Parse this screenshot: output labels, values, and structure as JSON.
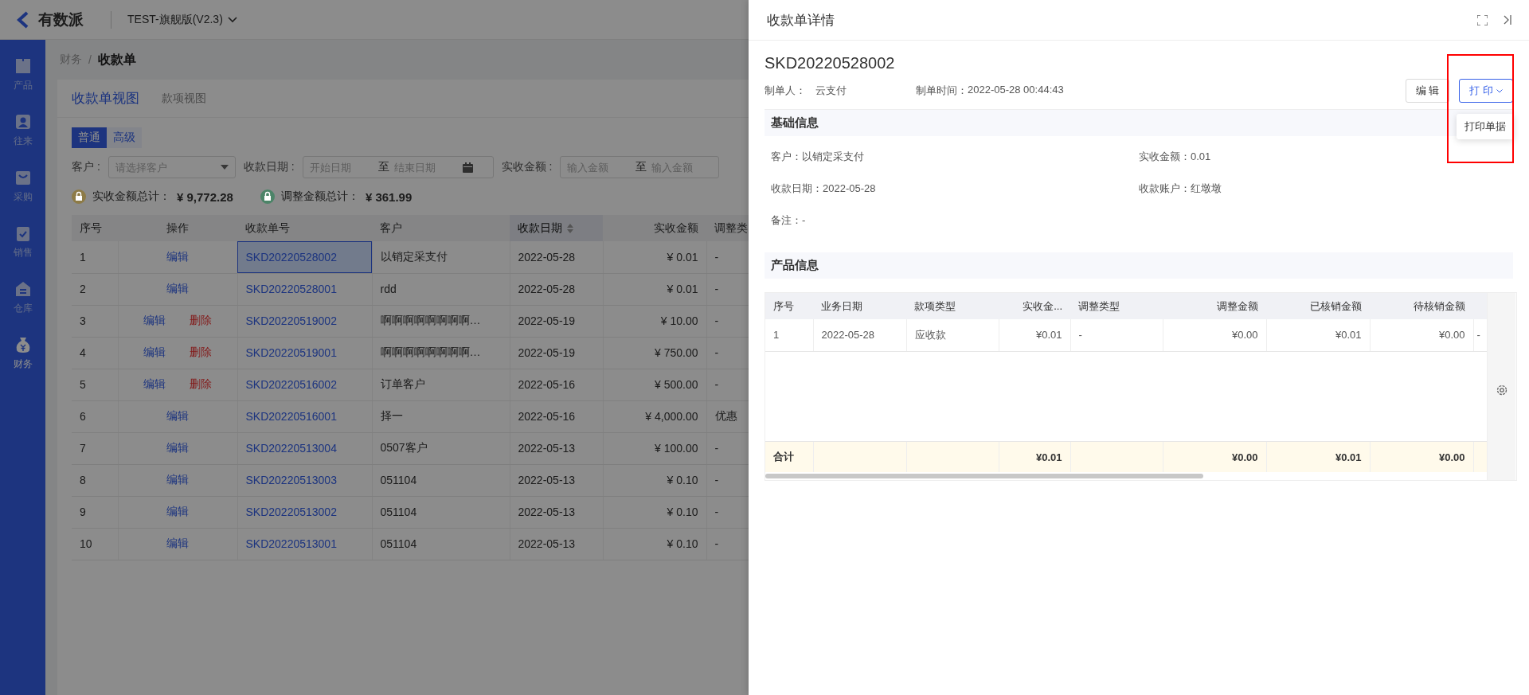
{
  "app": {
    "logo": "有数派",
    "workspace": "TEST-旗舰版(V2.3)"
  },
  "sidebar": {
    "items": [
      {
        "label": "产品",
        "selected": false
      },
      {
        "label": "往来",
        "selected": false
      },
      {
        "label": "采购",
        "selected": false
      },
      {
        "label": "销售",
        "selected": false
      },
      {
        "label": "仓库",
        "selected": false
      },
      {
        "label": "财务",
        "selected": true
      }
    ]
  },
  "breadcrumb": {
    "items": [
      "财务",
      "收款单"
    ],
    "separator": "/"
  },
  "view_tabs": [
    {
      "label": "收款单视图",
      "selected": true
    },
    {
      "label": "款项视图",
      "selected": false
    }
  ],
  "filter_mode": [
    {
      "label": "普通",
      "selected": true
    },
    {
      "label": "高级",
      "selected": false
    }
  ],
  "filters": [
    {
      "kind": "select",
      "label": "客户 :",
      "placeholder": "请选择客户"
    },
    {
      "kind": "date-range",
      "label": "收款日期 :",
      "from_placeholder": "开始日期",
      "separator": "至",
      "to_placeholder": "结束日期"
    },
    {
      "kind": "amount-range",
      "label": "实收金额 :",
      "from_placeholder": "输入金额",
      "separator": "至",
      "to_placeholder": "输入金额"
    }
  ],
  "totals": [
    {
      "label": "实收金额总计：",
      "value": "¥ 9,772.28",
      "color": "#8d7b47"
    },
    {
      "label": "调整金额总计：",
      "value": "¥ 361.99",
      "color": "#4c8468"
    }
  ],
  "table": {
    "columns": [
      {
        "label": "序号",
        "sortable": false
      },
      {
        "label": "操作",
        "sortable": false
      },
      {
        "label": "收款单号",
        "sortable": false
      },
      {
        "label": "客户",
        "sortable": false
      },
      {
        "label": "收款日期",
        "sortable": true
      },
      {
        "label": "实收金额",
        "sortable": false
      },
      {
        "label": "调整类",
        "sortable": false
      }
    ],
    "rows": [
      {
        "no": "1",
        "actions": [
          {
            "kind": "edit",
            "label": "编辑"
          }
        ],
        "number": "SKD20220528002",
        "customer": "以销定采支付",
        "date": "2022-05-28",
        "amount": "¥ 0.01",
        "adjust_type": "-",
        "selected": true
      },
      {
        "no": "2",
        "actions": [
          {
            "kind": "edit",
            "label": "编辑"
          }
        ],
        "number": "SKD20220528001",
        "customer": "rdd",
        "date": "2022-05-28",
        "amount": "¥ 0.01",
        "adjust_type": "-",
        "selected": false
      },
      {
        "no": "3",
        "actions": [
          {
            "kind": "edit",
            "label": "编辑"
          },
          {
            "kind": "delete",
            "label": "删除"
          }
        ],
        "number": "SKD20220519002",
        "customer": "啊啊啊啊啊啊啊啊…",
        "date": "2022-05-19",
        "amount": "¥ 10.00",
        "adjust_type": "-",
        "selected": false
      },
      {
        "no": "4",
        "actions": [
          {
            "kind": "edit",
            "label": "编辑"
          },
          {
            "kind": "delete",
            "label": "删除"
          }
        ],
        "number": "SKD20220519001",
        "customer": "啊啊啊啊啊啊啊啊…",
        "date": "2022-05-19",
        "amount": "¥ 750.00",
        "adjust_type": "-",
        "selected": false
      },
      {
        "no": "5",
        "actions": [
          {
            "kind": "edit",
            "label": "编辑"
          },
          {
            "kind": "delete",
            "label": "删除"
          }
        ],
        "number": "SKD20220516002",
        "customer": "订单客户",
        "date": "2022-05-16",
        "amount": "¥ 500.00",
        "adjust_type": "-",
        "selected": false
      },
      {
        "no": "6",
        "actions": [
          {
            "kind": "edit",
            "label": "编辑"
          }
        ],
        "number": "SKD20220516001",
        "customer": "择一",
        "date": "2022-05-16",
        "amount": "¥ 4,000.00",
        "adjust_type": "优惠",
        "selected": false
      },
      {
        "no": "7",
        "actions": [
          {
            "kind": "edit",
            "label": "编辑"
          }
        ],
        "number": "SKD20220513004",
        "customer": "0507客户",
        "date": "2022-05-13",
        "amount": "¥ 100.00",
        "adjust_type": "-",
        "selected": false
      },
      {
        "no": "8",
        "actions": [
          {
            "kind": "edit",
            "label": "编辑"
          }
        ],
        "number": "SKD20220513003",
        "customer": "051104",
        "date": "2022-05-13",
        "amount": "¥ 0.10",
        "adjust_type": "-",
        "selected": false
      },
      {
        "no": "9",
        "actions": [
          {
            "kind": "edit",
            "label": "编辑"
          }
        ],
        "number": "SKD20220513002",
        "customer": "051104",
        "date": "2022-05-13",
        "amount": "¥ 0.10",
        "adjust_type": "-",
        "selected": false
      },
      {
        "no": "10",
        "actions": [
          {
            "kind": "edit",
            "label": "编辑"
          }
        ],
        "number": "SKD20220513001",
        "customer": "051104",
        "date": "2022-05-13",
        "amount": "¥ 0.10",
        "adjust_type": "-",
        "selected": false
      }
    ]
  },
  "drawer": {
    "title": "收款单详情",
    "document_number": "SKD20220528002",
    "meta": [
      {
        "label": "制单人：",
        "value": "云支付"
      },
      {
        "label": "制单时间：",
        "value": "2022-05-28 00:44:43"
      }
    ],
    "buttons": [
      {
        "kind": "default",
        "label": "编 辑"
      },
      {
        "kind": "dropdown",
        "label": "打 印"
      }
    ],
    "print_menu": {
      "items": [
        "打印单据"
      ]
    },
    "annotation_frame": true,
    "basic_info": {
      "title": "基础信息",
      "fields": [
        {
          "text": "客户：以销定采支付"
        },
        {
          "text": "实收金额：0.01"
        },
        {
          "text": "收款日期：2022-05-28"
        },
        {
          "text": "收款账户：红墩墩"
        },
        {
          "text": "备注：-"
        }
      ]
    },
    "product_info": {
      "title": "产品信息",
      "table": {
        "columns": [
          {
            "label": "序号",
            "kind": "text"
          },
          {
            "label": "业务日期",
            "kind": "text"
          },
          {
            "label": "款项类型",
            "kind": "text"
          },
          {
            "label": "实收金...",
            "kind": "money"
          },
          {
            "label": "调整类型",
            "kind": "text"
          },
          {
            "label": "调整金额",
            "kind": "money"
          },
          {
            "label": "已核销金额",
            "kind": "money"
          },
          {
            "label": "待核销金额",
            "kind": "money"
          },
          {
            "kind": "text"
          }
        ],
        "rows": [
          {
            "cells": [
              "1",
              "2022-05-28",
              "应收款",
              "¥0.01",
              "-",
              "¥0.00",
              "¥0.01",
              "¥0.00",
              "-"
            ]
          }
        ],
        "totals": {
          "cells": [
            "合计",
            null,
            null,
            "¥0.01",
            null,
            "¥0.00",
            "¥0.01",
            "¥0.00",
            null
          ]
        }
      }
    }
  }
}
